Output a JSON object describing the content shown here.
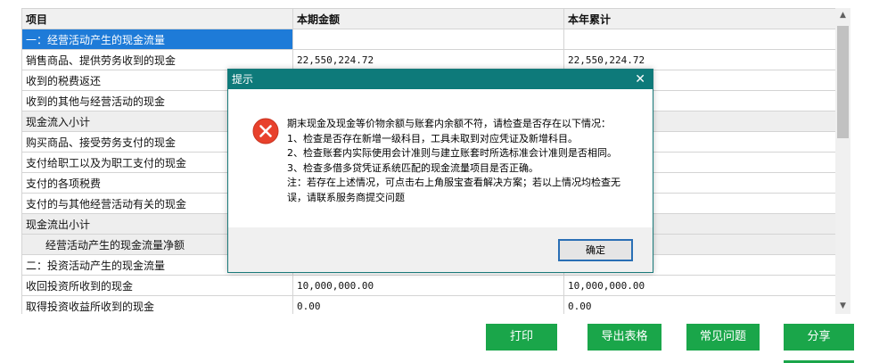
{
  "table": {
    "headers": [
      "项目",
      "本期金额",
      "本年累计"
    ],
    "rows": [
      {
        "item": "一：经营活动产生的现金流量",
        "current": "",
        "ytd": ""
      },
      {
        "item": "销售商品、提供劳务收到的现金",
        "current": "22,550,224.72",
        "ytd": "22,550,224.72"
      },
      {
        "item": "收到的税费返还",
        "current": "",
        "ytd": ""
      },
      {
        "item": "收到的其他与经营活动的现金",
        "current": "",
        "ytd": ""
      },
      {
        "item": "现金流入小计",
        "current": "",
        "ytd": ""
      },
      {
        "item": "购买商品、接受劳务支付的现金",
        "current": "",
        "ytd": ""
      },
      {
        "item": "支付给职工以及为职工支付的现金",
        "current": "",
        "ytd": ""
      },
      {
        "item": "支付的各项税费",
        "current": "",
        "ytd": ""
      },
      {
        "item": "支付的与其他经营活动有关的现金",
        "current": "",
        "ytd": ""
      },
      {
        "item": "现金流出小计",
        "current": "",
        "ytd": ""
      },
      {
        "item": "经营活动产生的现金流量净额",
        "current": "",
        "ytd": ""
      },
      {
        "item": "二：投资活动产生的现金流量",
        "current": "",
        "ytd": ""
      },
      {
        "item": "收回投资所收到的现金",
        "current": "10,000,000.00",
        "ytd": "10,000,000.00"
      },
      {
        "item": "取得投资收益所收到的现金",
        "current": "0.00",
        "ytd": "0.00"
      }
    ]
  },
  "buttons": {
    "print": "打印",
    "export": "导出表格",
    "faq": "常见问题",
    "share": "分享"
  },
  "dialog": {
    "title": "提示",
    "close": "✕",
    "message": "期末现金及现金等价物余额与账套内余额不符，请检查是否存在以下情况：\n1、检查是否存在新增一级科目，工具未取到对应凭证及新增科目。\n2、检查账套内实际使用会计准则与建立账套时所选标准会计准则是否相同。\n3、检查多借多贷凭证系统匹配的现金流量项目是否正确。\n注：若存在上述情况，可点击右上角服宝查看解决方案；若以上情况均检查无误，请联系服务商提交问题",
    "ok": "确定",
    "icon": "error-icon"
  },
  "colors": {
    "selection": "#1e7bd8",
    "dialog_title": "#0e7a7a",
    "button_green": "#1aa64a",
    "error_red": "#e8412c"
  }
}
